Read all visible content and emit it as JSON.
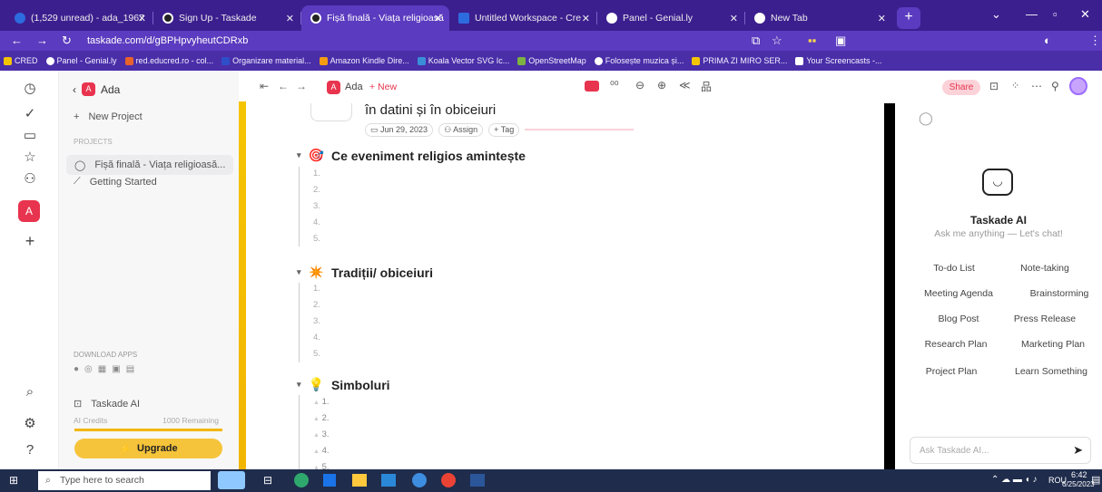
{
  "browser": {
    "tabs": [
      {
        "label": "(1,529 unread) - ada_1967",
        "icon_color": "#2d6cdf",
        "active": false
      },
      {
        "label": "Sign Up - Taskade",
        "icon_color": "#222",
        "active": false
      },
      {
        "label": "Fișă finală - Viața religioasă",
        "icon_color": "#222",
        "active": true
      },
      {
        "label": "Untitled Workspace - Cre",
        "icon_color": "#2d6cdf",
        "active": false
      },
      {
        "label": "Panel - Genial.ly",
        "icon_color": "#fff",
        "active": false
      },
      {
        "label": "New Tab",
        "icon_color": "#fff",
        "active": false
      }
    ],
    "url": "taskade.com/d/gBPHpvyheutCDRxb",
    "bookmarks": [
      "CRED",
      "Panel - Genial.ly",
      "red.educred.ro - col...",
      "Organizare material...",
      "Amazon Kindle Dire...",
      "Koala Vector SVG Ic...",
      "OpenStreetMap",
      "Folosește muzica și...",
      "PRIMA ZI MIRO SER...",
      "Your Screencasts -..."
    ]
  },
  "sidebar": {
    "workspace": "Ada",
    "new_project": "New Project",
    "projects_header": "PROJECTS",
    "projects": [
      "Fișă finală - Viața religioasă...",
      "Getting Started"
    ],
    "download_apps": "DOWNLOAD APPS",
    "taskade_ai": "Taskade AI",
    "ai_credits_label": "AI Credits",
    "ai_credits_value": "1000 Remaining",
    "upgrade": "Upgrade",
    "rail_avatar": "A"
  },
  "doc_toolbar": {
    "workspace": "Ada",
    "new_label": "+ New",
    "share": "Share"
  },
  "document": {
    "title_fragment": "în datini și în obiceiuri",
    "date": "Jun 29, 2023",
    "assign": "Assign",
    "tag": "+ Tag",
    "sections": [
      {
        "emoji": "🎯",
        "title": "Ce eveniment religios amintește",
        "items": [
          "1.",
          "2.",
          "3.",
          "4.",
          "5."
        ]
      },
      {
        "emoji": "✴️",
        "title": "Tradiții/ obiceiuri",
        "items": [
          "1.",
          "2.",
          "3.",
          "4.",
          "5."
        ]
      },
      {
        "emoji": "💡",
        "title": "Simboluri",
        "items": [
          "1.",
          "2.",
          "3.",
          "4.",
          "5."
        ]
      }
    ]
  },
  "ai_panel": {
    "title": "Taskade AI",
    "subtitle": "Ask me anything — Let's chat!",
    "chips": [
      "To-do List",
      "Note-taking",
      "Meeting Agenda",
      "Brainstorming",
      "Blog Post",
      "Press Release",
      "Research Plan",
      "Marketing Plan",
      "Project Plan",
      "Learn Something"
    ],
    "input_placeholder": "Ask Taskade AI..."
  },
  "taskbar": {
    "search_placeholder": "Type here to search",
    "lang": "ROU",
    "time": "6:42",
    "date": "6/25/2023"
  },
  "colors": {
    "tab_bar": "#3c1f8f",
    "brand": "#e8344e",
    "upgrade": "#f6c43a",
    "accent_purple": "#5b3bbf"
  }
}
